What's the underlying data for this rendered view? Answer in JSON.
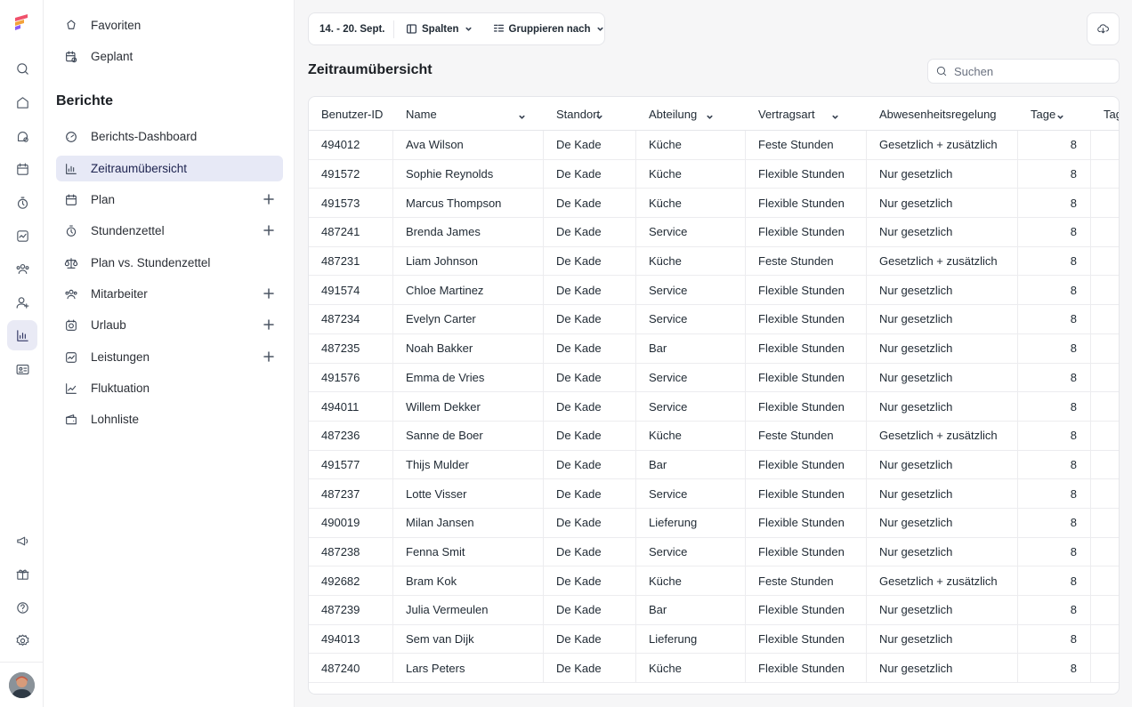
{
  "rail": {
    "items": [
      {
        "icon": "search-icon"
      },
      {
        "icon": "home-icon"
      },
      {
        "icon": "inbox-icon"
      },
      {
        "icon": "calendar-icon"
      },
      {
        "icon": "timer-icon"
      },
      {
        "icon": "activity-icon"
      },
      {
        "icon": "team-icon"
      },
      {
        "icon": "user-plus-icon"
      },
      {
        "icon": "chart-icon",
        "active": true
      },
      {
        "icon": "id-card-icon"
      }
    ],
    "bottom_items": [
      {
        "icon": "megaphone-icon"
      },
      {
        "icon": "gift-icon"
      },
      {
        "icon": "help-icon"
      },
      {
        "icon": "settings-icon"
      }
    ]
  },
  "sidebar": {
    "top_items": [
      {
        "label": "Favoriten",
        "icon": "star-icon"
      },
      {
        "label": "Geplant",
        "icon": "scheduled-icon"
      }
    ],
    "section_title": "Berichte",
    "items": [
      {
        "label": "Berichts-Dashboard",
        "icon": "gauge-icon"
      },
      {
        "label": "Zeitraumübersicht",
        "icon": "bar-chart-icon",
        "active": true
      },
      {
        "label": "Plan",
        "icon": "calendar-icon",
        "plus": true
      },
      {
        "label": "Stundenzettel",
        "icon": "timer-icon",
        "plus": true
      },
      {
        "label": "Plan vs. Stundenzettel",
        "icon": "scale-icon"
      },
      {
        "label": "Mitarbeiter",
        "icon": "team-icon",
        "plus": true
      },
      {
        "label": "Urlaub",
        "icon": "vacation-icon",
        "plus": true
      },
      {
        "label": "Leistungen",
        "icon": "activity-icon",
        "plus": true
      },
      {
        "label": "Fluktuation",
        "icon": "trend-icon"
      },
      {
        "label": "Lohnliste",
        "icon": "wallet-icon"
      }
    ]
  },
  "toolbar": {
    "date_range": "14. - 20. Sept.",
    "columns_label": "Spalten",
    "group_label": "Gruppieren nach"
  },
  "page_title": "Zeitraumübersicht",
  "search": {
    "placeholder": "Suchen",
    "value": ""
  },
  "table": {
    "headers": [
      "Benutzer-ID",
      "Name",
      "Standort",
      "Abteilung",
      "Vertragsart",
      "Abwesenheitsregelung",
      "Tage",
      "Tag"
    ],
    "rows": [
      [
        "494012",
        "Ava Wilson",
        "De Kade",
        "Küche",
        "Feste Stunden",
        "Gesetzlich + zusätzlich",
        "8"
      ],
      [
        "491572",
        "Sophie Reynolds",
        "De Kade",
        "Küche",
        "Flexible Stunden",
        "Nur gesetzlich",
        "8"
      ],
      [
        "491573",
        "Marcus Thompson",
        "De Kade",
        "Küche",
        "Flexible Stunden",
        "Nur gesetzlich",
        "8"
      ],
      [
        "487241",
        "Brenda James",
        "De Kade",
        "Service",
        "Flexible Stunden",
        "Nur gesetzlich",
        "8"
      ],
      [
        "487231",
        "Liam Johnson",
        "De Kade",
        "Küche",
        "Feste Stunden",
        "Gesetzlich + zusätzlich",
        "8"
      ],
      [
        "491574",
        "Chloe Martinez",
        "De Kade",
        "Service",
        "Flexible Stunden",
        "Nur gesetzlich",
        "8"
      ],
      [
        "487234",
        "Evelyn Carter",
        "De Kade",
        "Service",
        "Flexible Stunden",
        "Nur gesetzlich",
        "8"
      ],
      [
        "487235",
        "Noah Bakker",
        "De Kade",
        "Bar",
        "Flexible Stunden",
        "Nur gesetzlich",
        "8"
      ],
      [
        "491576",
        "Emma de Vries",
        "De Kade",
        "Service",
        "Flexible Stunden",
        "Nur gesetzlich",
        "8"
      ],
      [
        "494011",
        "Willem Dekker",
        "De Kade",
        "Service",
        "Flexible Stunden",
        "Nur gesetzlich",
        "8"
      ],
      [
        "487236",
        "Sanne de Boer",
        "De Kade",
        "Küche",
        "Feste Stunden",
        "Gesetzlich + zusätzlich",
        "8"
      ],
      [
        "491577",
        "Thijs Mulder",
        "De Kade",
        "Bar",
        "Flexible Stunden",
        "Nur gesetzlich",
        "8"
      ],
      [
        "487237",
        "Lotte Visser",
        "De Kade",
        "Service",
        "Flexible Stunden",
        "Nur gesetzlich",
        "8"
      ],
      [
        "490019",
        "Milan Jansen",
        "De Kade",
        "Lieferung",
        "Flexible Stunden",
        "Nur gesetzlich",
        "8"
      ],
      [
        "487238",
        "Fenna Smit",
        "De Kade",
        "Service",
        "Flexible Stunden",
        "Nur gesetzlich",
        "8"
      ],
      [
        "492682",
        "Bram Kok",
        "De Kade",
        "Küche",
        "Feste Stunden",
        "Gesetzlich + zusätzlich",
        "8"
      ],
      [
        "487239",
        "Julia Vermeulen",
        "De Kade",
        "Bar",
        "Flexible Stunden",
        "Nur gesetzlich",
        "8"
      ],
      [
        "494013",
        "Sem van Dijk",
        "De Kade",
        "Lieferung",
        "Flexible Stunden",
        "Nur gesetzlich",
        "8"
      ],
      [
        "487240",
        "Lars Peters",
        "De Kade",
        "Küche",
        "Flexible Stunden",
        "Nur gesetzlich",
        "8"
      ]
    ]
  },
  "colors": {
    "active_bg": "#e7e9f6",
    "accent_logo": [
      "#f0516b",
      "#f3a23b",
      "#8b5cf6"
    ]
  }
}
